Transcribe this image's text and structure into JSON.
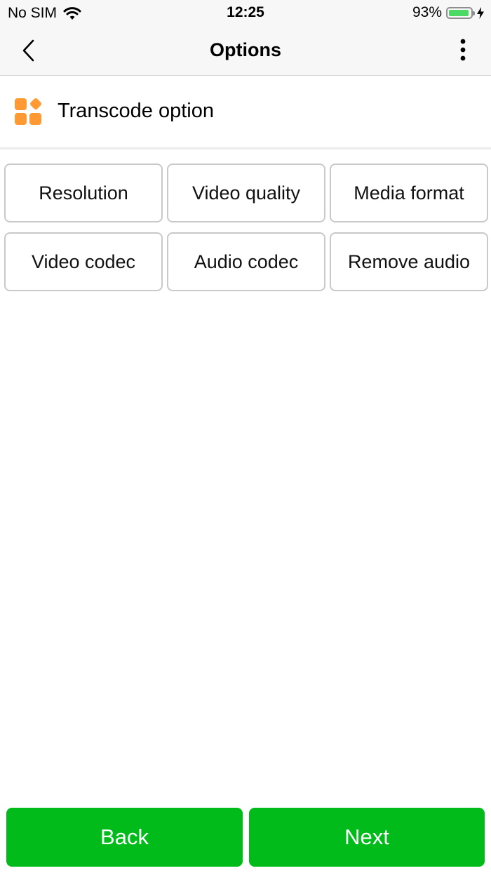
{
  "status_bar": {
    "carrier": "No SIM",
    "time": "12:25",
    "battery_percent": "93%",
    "battery_level": 0.93,
    "icons": [
      "wifi-icon",
      "battery-icon",
      "charging-bolt-icon"
    ]
  },
  "nav": {
    "title": "Options",
    "back_icon": "chevron-left-icon",
    "more_icon": "more-vertical-icon"
  },
  "section": {
    "title": "Transcode option",
    "icon": "apps-grid-icon"
  },
  "options": [
    {
      "label": "Resolution"
    },
    {
      "label": "Video quality"
    },
    {
      "label": "Media format"
    },
    {
      "label": "Video codec"
    },
    {
      "label": "Audio codec"
    },
    {
      "label": "Remove audio"
    }
  ],
  "footer": {
    "back_label": "Back",
    "next_label": "Next"
  },
  "colors": {
    "accent_green": "#00bb1a",
    "icon_orange": "#ff9933",
    "battery_green": "#4cd964",
    "border_gray": "#c9c9c9"
  }
}
